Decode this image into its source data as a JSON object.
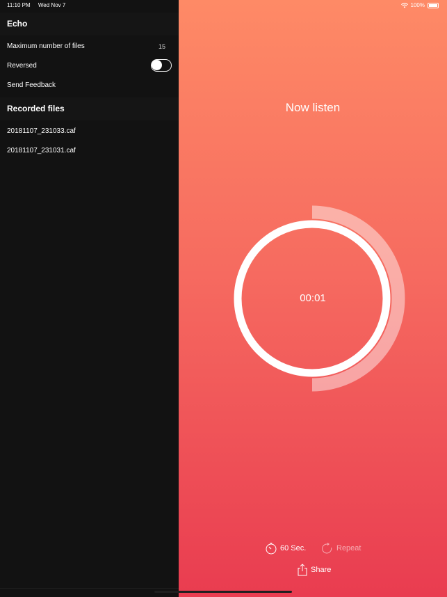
{
  "status": {
    "time": "11:10 PM",
    "date": "Wed Nov 7",
    "battery": "100%"
  },
  "sidebar": {
    "app_title": "Echo",
    "settings": {
      "max_files_label": "Maximum number of files",
      "max_files_value": "15",
      "reversed_label": "Reversed",
      "reversed_on": false,
      "feedback_label": "Send Feedback"
    },
    "recorded_header": "Recorded files",
    "files": [
      "20181107_231033.caf",
      "20181107_231031.caf"
    ]
  },
  "main": {
    "title": "Now listen",
    "timer": "00:01",
    "progress": 0.5,
    "duration_label": "60 Sec.",
    "repeat_label": "Repeat",
    "share_label": "Share"
  },
  "colors": {
    "gradient_top": "#fe8a66",
    "gradient_bottom": "#e93c50",
    "sidebar_bg": "#121212"
  }
}
